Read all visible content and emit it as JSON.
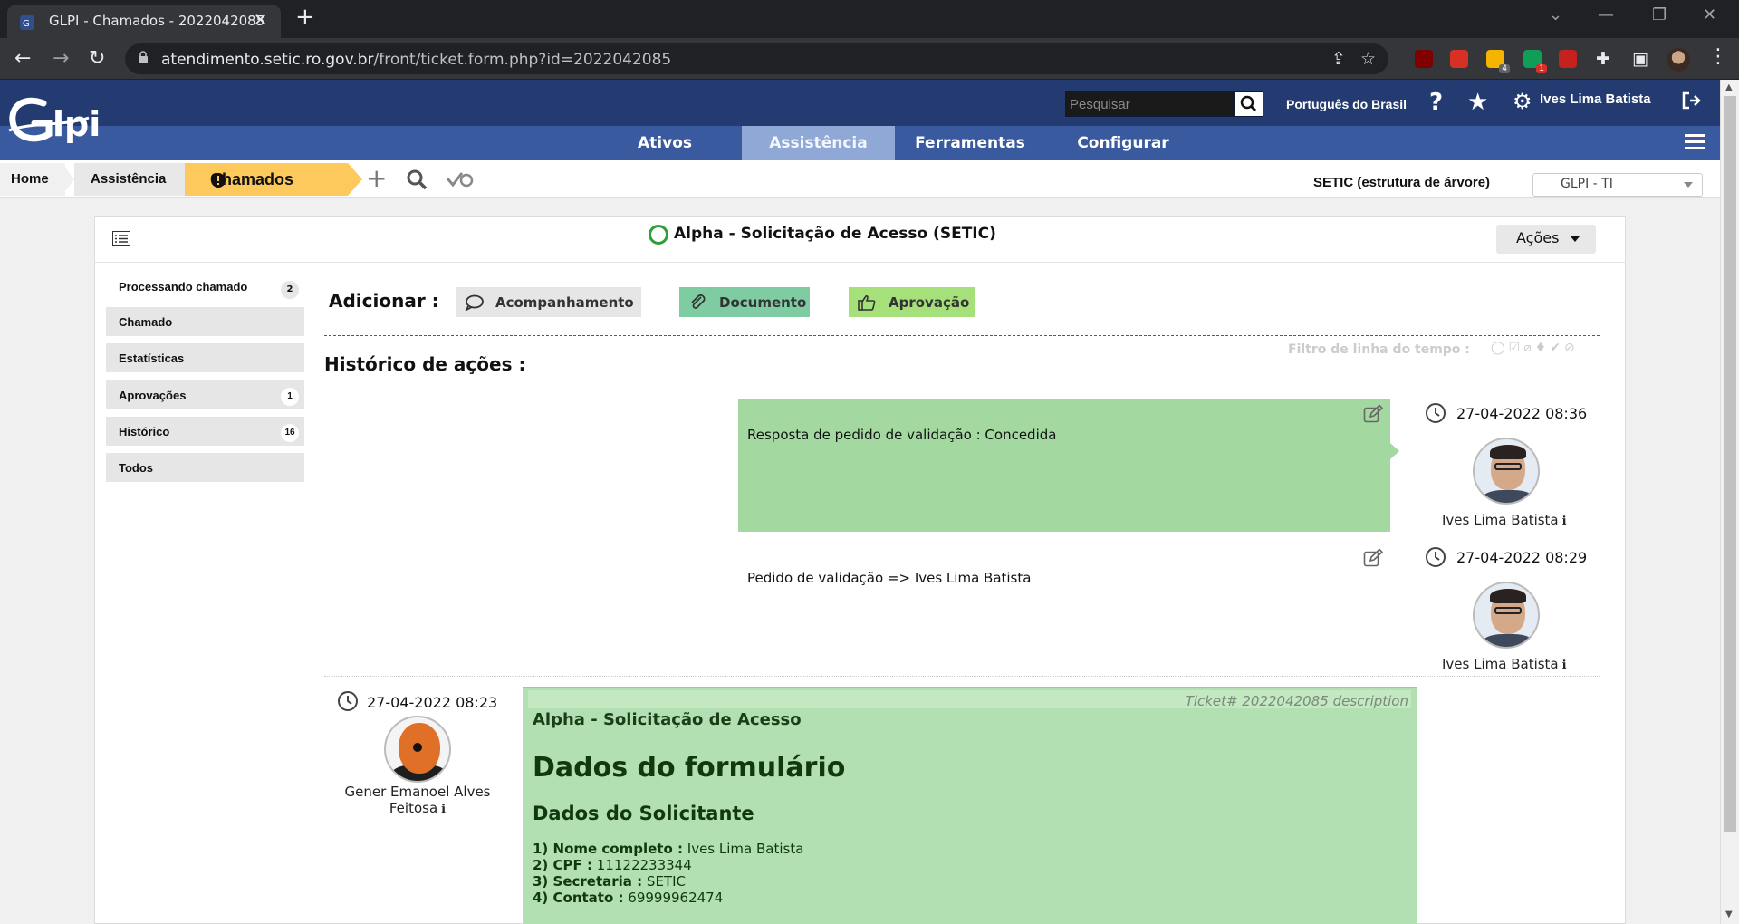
{
  "browser": {
    "tab_title": "GLPI - Chamados - 2022042085",
    "url_host": "atendimento.setic.ro.gov.br",
    "url_path": "/front/ticket.form.php?id=2022042085",
    "extensions": [
      {
        "name": "ublock-icon",
        "color": "#800000",
        "badge": ""
      },
      {
        "name": "blocker-icon",
        "color": "#d93025",
        "badge": ""
      },
      {
        "name": "sticky-note-icon",
        "color": "#f4b400",
        "badge": "4"
      },
      {
        "name": "mindmap-icon",
        "color": "#0f9d58",
        "badge": "1"
      },
      {
        "name": "pin-icon",
        "color": "#c5221f",
        "badge": ""
      }
    ]
  },
  "glpi": {
    "search_placeholder": "Pesquisar",
    "language": "Português do Brasil",
    "user": "Ives Lima Batista",
    "menu": [
      {
        "label": "Ativos",
        "active": false
      },
      {
        "label": "Assistência",
        "active": true
      },
      {
        "label": "Ferramentas",
        "active": false
      },
      {
        "label": "Configurar",
        "active": false
      }
    ],
    "breadcrumb": {
      "home": "Home",
      "section": "Assistência",
      "current": "Chamados"
    },
    "entity_label": "SETIC (estrutura de árvore)",
    "entity_select": "GLPI - TI"
  },
  "ticket": {
    "title": "Alpha - Solicitação de Acesso (SETIC)",
    "actions_label": "Ações",
    "status_color": "#2e9e3a"
  },
  "sidebar": {
    "title": "Processando chamado",
    "title_badge": "2",
    "tabs": [
      {
        "label": "Chamado",
        "badge": ""
      },
      {
        "label": "Estatísticas",
        "badge": ""
      },
      {
        "label": "Aprovações",
        "badge": "1"
      },
      {
        "label": "Histórico",
        "badge": "16"
      },
      {
        "label": "Todos",
        "badge": ""
      }
    ]
  },
  "timeline": {
    "add_label": "Adicionar :",
    "add_buttons": [
      {
        "label": "Acompanhamento",
        "color": "#e6e6e6",
        "icon": "comment-icon"
      },
      {
        "label": "Documento",
        "color": "#7fcca3",
        "icon": "paperclip-icon"
      },
      {
        "label": "Aprovação",
        "color": "#a5e07a",
        "icon": "thumbs-up-icon"
      }
    ],
    "history_title": "Histórico de ações :",
    "filter_label": "Filtro de linha do tempo :",
    "items": [
      {
        "text": "Resposta de pedido de validação : Concedida",
        "date": "27-04-2022 08:36",
        "author": "Ives Lima Batista",
        "bg": "#a3d9a0"
      },
      {
        "text": "Pedido de validação => Ives Lima Batista",
        "date": "27-04-2022 08:29",
        "author": "Ives Lima Batista",
        "bg": "#ffffff"
      }
    ],
    "description": {
      "date": "27-04-2022 08:23",
      "author_line1": "Gener Emanoel Alves",
      "author_line2": "Feitosa",
      "meta": "Ticket# 2022042085 description",
      "subject": "Alpha - Solicitação de Acesso",
      "heading": "Dados do formulário",
      "subheading": "Dados do Solicitante",
      "fields": [
        {
          "label": "1) Nome completo :",
          "value": "Ives Lima Batista"
        },
        {
          "label": "2) CPF :",
          "value": "11122233344"
        },
        {
          "label": "3) Secretaria :",
          "value": "SETIC"
        },
        {
          "label": "4) Contato :",
          "value": "69999962474"
        }
      ]
    }
  }
}
